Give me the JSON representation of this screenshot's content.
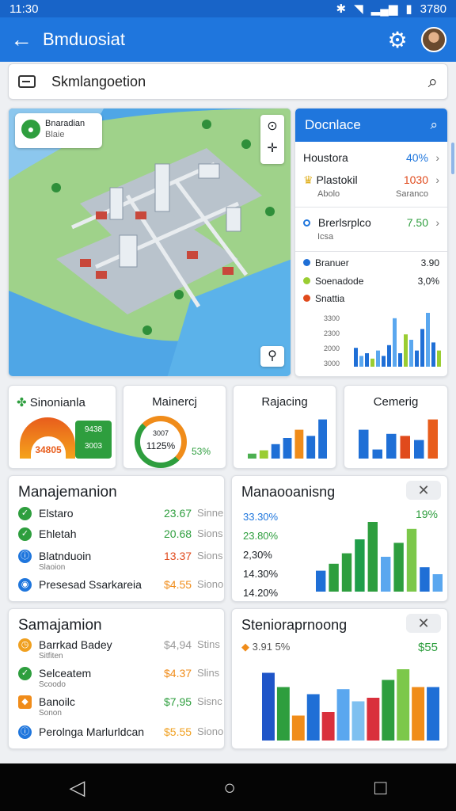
{
  "status": {
    "time": "11:30",
    "battery": "3780"
  },
  "app_bar": {
    "title": "Bmduosiat"
  },
  "search": {
    "value": "Skmlangoetion"
  },
  "map": {
    "chip_title": "Bnaradian",
    "chip_sub": "Blaie"
  },
  "panel": {
    "title": "Docnlace",
    "rows": [
      {
        "label": "Houstora",
        "value": "40%"
      },
      {
        "label": "Plastokil",
        "value": "1030",
        "sub_left": "Abolo",
        "sub_right": "Saranco"
      },
      {
        "label": "Brerlsrplco",
        "value": "7.50",
        "sub": "Icsa"
      }
    ],
    "legend": [
      {
        "label": "Branuer",
        "value": "3.90",
        "color": "#1f6fd6"
      },
      {
        "label": "Soenadode",
        "value": "3,0%",
        "color": "#9acd32"
      },
      {
        "label": "Snattia",
        "value": "",
        "color": "#e04a1c"
      }
    ],
    "y_ticks": [
      "3300",
      "2300",
      "2000",
      "3000"
    ],
    "bars": [
      0.35,
      0.2,
      0.25,
      0.15,
      0.3,
      0.2,
      0.4,
      0.9,
      0.25,
      0.6,
      0.5,
      0.3,
      0.7,
      1.0,
      0.45,
      0.3
    ]
  },
  "mini_cards": [
    {
      "title": "Sinonianla",
      "left_value": "34805",
      "right_value": "3003",
      "right_label": "9438"
    },
    {
      "title": "Mainercj",
      "value": "1125%",
      "small": "3007",
      "pct": "53%"
    },
    {
      "title": "Rajacing"
    },
    {
      "title": "Cemerig"
    }
  ],
  "mini_bars": {
    "rajacing": [
      0.12,
      0.2,
      0.35,
      0.5,
      0.7,
      0.55,
      0.95
    ],
    "cemerig": [
      0.7,
      0.22,
      0.6,
      0.55,
      0.45,
      0.95
    ]
  },
  "list_top": {
    "title": "Manajemanion",
    "items": [
      {
        "label": "Elstaro",
        "amount": "23.67",
        "unit": "Sinne",
        "color": "#2e9e3e",
        "amount_color": "#2e9e3e"
      },
      {
        "label": "Ehletah",
        "amount": "20.68",
        "unit": "Sions",
        "color": "#2e9e3e",
        "amount_color": "#2e9e3e"
      },
      {
        "label": "Blatnduoin",
        "amount": "13.37",
        "unit": "Sions",
        "sub": "Slaoion",
        "color": "#1f76dd",
        "amount_color": "#e04a1c"
      },
      {
        "label": "Presesad Ssarkareia",
        "amount": "$4.55",
        "unit": "Siono",
        "color": "#1f76dd",
        "amount_color": "#f08c1a"
      }
    ]
  },
  "chart_top": {
    "title": "Manaooanisng",
    "pct": "19%",
    "labels": [
      "33.30%",
      "23.80%",
      "2,30%",
      "14.30%",
      "14.20%"
    ],
    "values": [
      0.3,
      0.4,
      0.55,
      0.75,
      1.0,
      0.5,
      0.7,
      0.9,
      0.35,
      0.25
    ]
  },
  "list_bottom": {
    "title": "Samajamion",
    "items": [
      {
        "label": "Barrkad Badey",
        "sub": "Sitfiten",
        "amount": "$4,94",
        "unit": "Stins",
        "color": "#f0a020",
        "amount_color": "#999"
      },
      {
        "label": "Selceatem",
        "sub": "Scoodo",
        "amount": "$4.37",
        "unit": "Slins",
        "color": "#2e9e3e",
        "amount_color": "#f08c1a"
      },
      {
        "label": "Banoilc",
        "sub": "Sonon",
        "amount": "$7,95",
        "unit": "Sisnc",
        "color": "#f08c1a",
        "amount_color": "#2e9e3e"
      },
      {
        "label": "Perolnga Marlurldcan",
        "amount": "$5.55",
        "unit": "Siono",
        "color": "#1f76dd",
        "amount_color": "#f0a020"
      }
    ]
  },
  "chart_bottom": {
    "title": "Stenioraprnoong",
    "pct_label": "3.91 5%",
    "value": "$55",
    "values": [
      0.95,
      0.75,
      0.35,
      0.65,
      0.4,
      0.72,
      0.55,
      0.6,
      0.85,
      1.0,
      0.75,
      0.75
    ]
  }
}
